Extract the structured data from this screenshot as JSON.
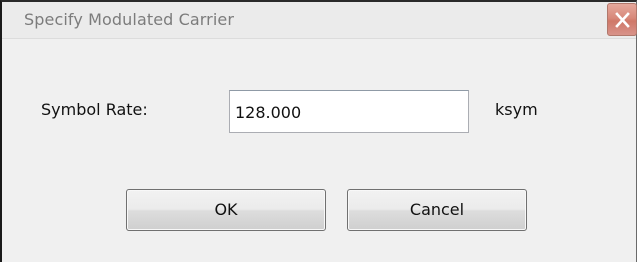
{
  "window": {
    "title": "Specify Modulated Carrier",
    "close_icon": "close-icon"
  },
  "symbol_rate": {
    "label": "Symbol Rate:",
    "value": "128.000",
    "unit": "ksym"
  },
  "buttons": {
    "ok_label": "OK",
    "cancel_label": "Cancel"
  },
  "colors": {
    "dialog_background": "#f0f0f0",
    "title_text": "#7c7c7c",
    "close_button": "#d8897a",
    "input_background": "#ffffff"
  }
}
